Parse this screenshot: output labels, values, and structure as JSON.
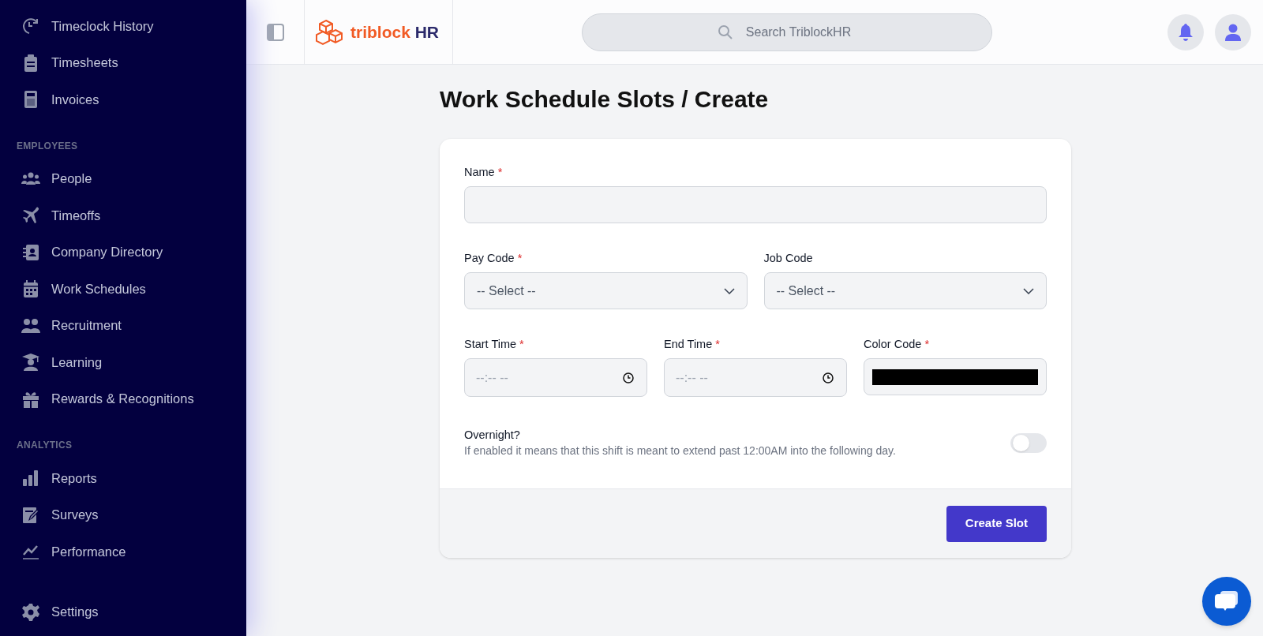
{
  "sidebar": {
    "sections": [
      {
        "items": [
          {
            "label": "Timeclock History"
          },
          {
            "label": "Timesheets"
          },
          {
            "label": "Invoices"
          }
        ]
      },
      {
        "heading": "EMPLOYEES",
        "items": [
          {
            "label": "People"
          },
          {
            "label": "Timeoffs"
          },
          {
            "label": "Company Directory"
          },
          {
            "label": "Work Schedules"
          },
          {
            "label": "Recruitment"
          },
          {
            "label": "Learning"
          },
          {
            "label": "Rewards & Recognitions"
          }
        ]
      },
      {
        "heading": "ANALYTICS",
        "items": [
          {
            "label": "Reports"
          },
          {
            "label": "Surveys"
          },
          {
            "label": "Performance"
          }
        ]
      },
      {
        "items": [
          {
            "label": "Settings"
          }
        ]
      }
    ]
  },
  "header": {
    "logo": {
      "brand": "triblock",
      "suffix": "HR"
    },
    "search": {
      "placeholder": "Search TriblockHR"
    }
  },
  "page": {
    "title": "Work Schedule Slots / Create"
  },
  "form": {
    "rows": [
      [
        {
          "kind": "text",
          "label": "Name",
          "required_mark": "*"
        }
      ],
      [
        {
          "kind": "select",
          "label": "Pay Code",
          "required_mark": "*",
          "placeholder": "-- Select --"
        },
        {
          "kind": "select",
          "label": "Job Code",
          "placeholder": "-- Select --"
        }
      ],
      [
        {
          "kind": "time",
          "label": "Start Time",
          "required_mark": "*",
          "placeholder": "--:-- --"
        },
        {
          "kind": "time",
          "label": "End Time",
          "required_mark": "*",
          "placeholder": "--:-- --"
        },
        {
          "kind": "color",
          "label": "Color Code",
          "required_mark": "*",
          "color": "#000000"
        }
      ]
    ],
    "toggle": {
      "label": "Overnight?",
      "description": "If enabled it means that this shift is meant to extend past 12:00AM into the following day.",
      "on": false
    },
    "submit": "Create Slot"
  }
}
